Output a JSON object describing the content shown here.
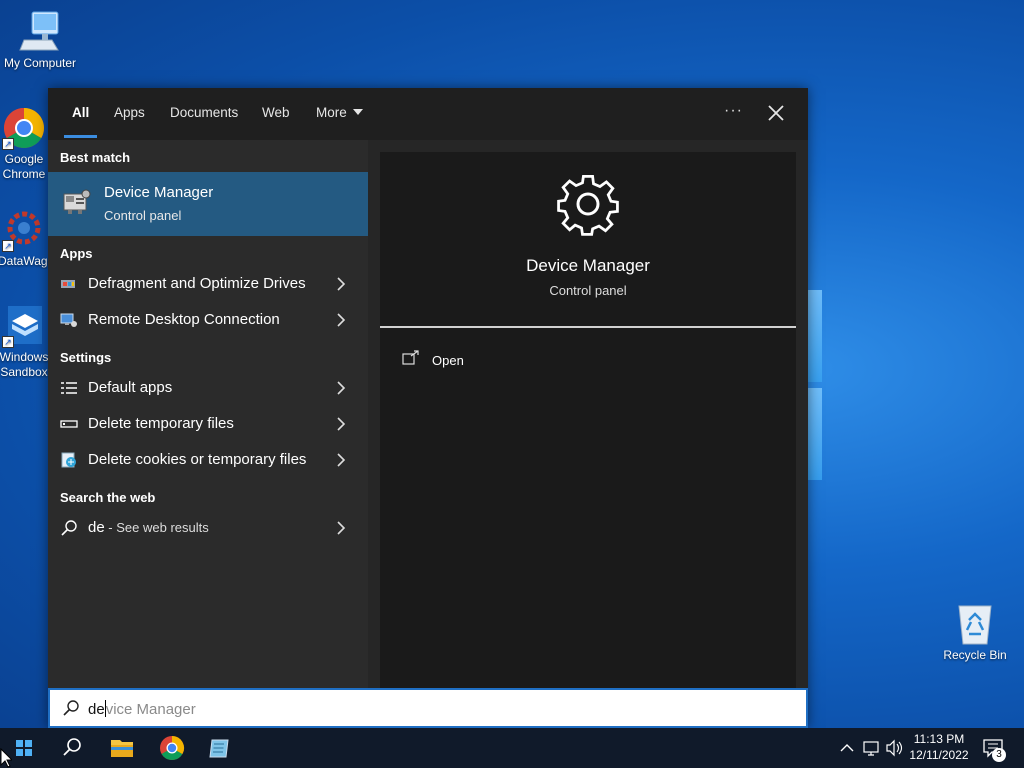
{
  "desktop": {
    "icons": [
      {
        "label": "My Computer",
        "icon": "computer-icon"
      },
      {
        "label": "Google Chrome",
        "icon": "chrome-icon"
      },
      {
        "label": "DataWagon",
        "icon": "gear-app-icon"
      },
      {
        "label": "Windows Sandbox",
        "icon": "sandbox-icon"
      },
      {
        "label": "Recycle Bin",
        "icon": "recycle-bin-icon"
      }
    ]
  },
  "search_menu": {
    "tabs": [
      {
        "label": "All",
        "active": true
      },
      {
        "label": "Apps",
        "active": false
      },
      {
        "label": "Documents",
        "active": false
      },
      {
        "label": "Web",
        "active": false
      },
      {
        "label": "More",
        "active": false
      }
    ],
    "more_icon": "ellipsis-icon",
    "close_icon": "close-icon",
    "best_match": {
      "section": "Best match",
      "title": "Device Manager",
      "subtitle": "Control panel",
      "icon": "device-manager-icon"
    },
    "apps": {
      "section": "Apps",
      "items": [
        {
          "label": "Defragment and Optimize Drives",
          "icon": "defrag-icon"
        },
        {
          "label": "Remote Desktop Connection",
          "icon": "remote-desktop-icon"
        }
      ]
    },
    "settings": {
      "section": "Settings",
      "items": [
        {
          "label": "Default apps",
          "icon": "list-icon"
        },
        {
          "label": "Delete temporary files",
          "icon": "drive-icon"
        },
        {
          "label": "Delete cookies or temporary files",
          "icon": "internet-options-icon"
        }
      ]
    },
    "web": {
      "section": "Search the web",
      "query": "de",
      "suffix": " - See web results",
      "icon": "search-icon"
    },
    "detail": {
      "title": "Device Manager",
      "subtitle": "Control panel",
      "icon": "gear-icon",
      "actions": [
        {
          "label": "Open",
          "icon": "open-icon"
        }
      ]
    },
    "search_box": {
      "typed": "de",
      "suggestion": "vice Manager",
      "icon": "search-icon"
    }
  },
  "taskbar": {
    "pinned": [
      "windows-start-icon",
      "search-icon",
      "file-explorer-icon",
      "chrome-icon",
      "notepad-icon"
    ],
    "tray_icons": [
      "chevron-up-icon",
      "network-icon",
      "volume-icon"
    ],
    "time": "11:13 PM",
    "date": "12/11/2022",
    "notification_count": "3"
  },
  "colors": {
    "accent": "#3b8de0",
    "highlight": "#245a82",
    "menu_bg": "#2b2b2b",
    "detail_bg": "#1a1a1a"
  }
}
